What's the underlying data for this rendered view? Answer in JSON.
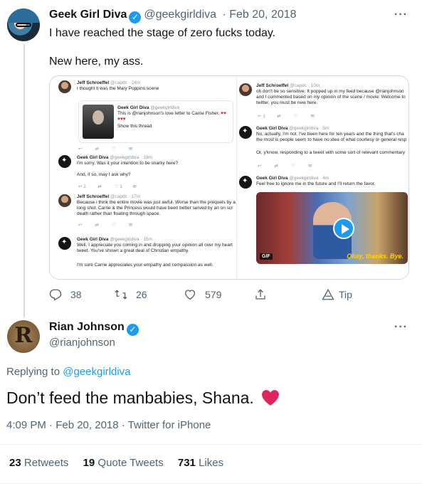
{
  "tweet": {
    "author_name": "Geek Girl Diva",
    "author_handle": "@geekgirldiva",
    "date": "· Feb 20, 2018",
    "more": "···",
    "text_line1": "I have reached the stage of zero fucks today.",
    "text_line2": "New here, my ass.",
    "embedded": {
      "left": [
        {
          "name": "Jeff Schroeffel",
          "handle": "@capdc · 24m",
          "text": "I thought it was the Mary Poppins scene"
        },
        {
          "quoted_name": "Geek Girl Diva",
          "quoted_handle": "@geekgirldiva",
          "quoted_text": "This is @rianjohnson's love letter to Carrie Fisher.",
          "show_thread": "Show this thread"
        },
        {
          "name": "Geek Girl Diva",
          "handle": "@geekgirldiva · 19m",
          "text1": "I'm sorry. Was it your intention to be snarky here?",
          "text2": "And, if so, may I ask why?"
        },
        {
          "name": "Jeff Schroeffel",
          "handle": "@capdc · 17m",
          "text1": "Because i think the entire movie was just awful. Worse than the prequels by a",
          "text2": "long shot. Carrie & the Princess would have been better served by an on scr",
          "text3": "death rather than floating through space."
        },
        {
          "name": "Geek Girl Diva",
          "handle": "@geekgirldiva · 15m",
          "text1": "Well. I appreciate you coming in and dropping your opinion all over my heart",
          "text2": "tweet. You've shown a great deal of Christian empathy.",
          "text3": "I'm sure Carrie appreciates your empathy and compassion as well."
        }
      ],
      "right": [
        {
          "name": "Jeff Schroeffel",
          "handle": "@capdc · 10m",
          "text1": "oh don't be so sensitive.  It popped up in my feed because @rianjohnson",
          "text2": "and I commented based on my opinion of the scene / movie. Welcome to",
          "text3": "twitter, you must be new here."
        },
        {
          "name": "Geek Girl Diva",
          "handle": "@geekgirldiva · 5m",
          "text1": "No, actually, I'm not. I've been here for ten years and the thing that's cha",
          "text2": "the most is people seem to have no idea of what courtesy or general resp",
          "text3": "Or, y'know, responding to a tweet with some sort of relevant commentary"
        },
        {
          "name": "Geek Girl Diva",
          "handle": "@geekgirldiva · 4m",
          "text1": "Feel free to ignore me in the future and I'll return the favor."
        }
      ],
      "gif_label": "GIF",
      "gif_caption": "Okay, thanks. Bye."
    },
    "actions": {
      "replies": "38",
      "retweets": "26",
      "likes": "579",
      "tip": "Tip"
    }
  },
  "reply": {
    "author_name": "Rian Johnson",
    "author_handle": "@rianjohnson",
    "avatar_letter": "R",
    "more": "···",
    "replying_prefix": "Replying to",
    "replying_to": "@geekgirldiva",
    "text": "Don’t feed the manbabies, Shana.",
    "meta": "4:09 PM · Feb 20, 2018 · Twitter for iPhone",
    "stats": {
      "retweets_count": "23",
      "retweets_label": "Retweets",
      "quotes_count": "19",
      "quotes_label": "Quote Tweets",
      "likes_count": "731",
      "likes_label": "Likes"
    }
  },
  "colors": {
    "accent": "#1d9bf0",
    "secondary_text": "#536471",
    "heart": "#e0245e"
  },
  "icons": [
    "reply-icon",
    "retweet-icon",
    "like-icon",
    "share-icon",
    "tip-icon",
    "verified-badge-icon",
    "heart-emoji-icon"
  ]
}
